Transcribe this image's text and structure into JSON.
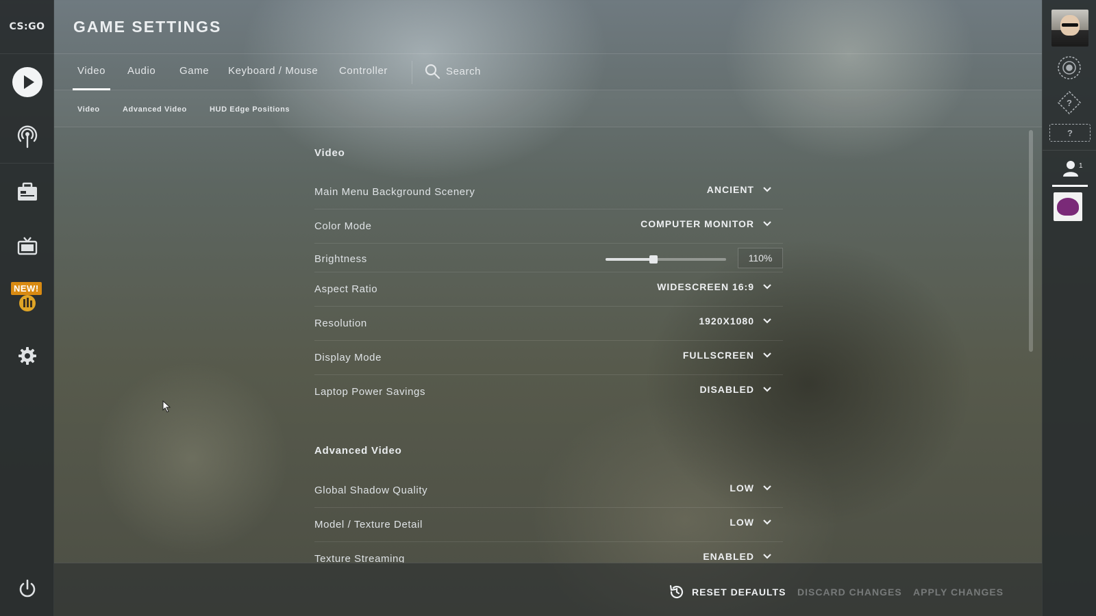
{
  "app": {
    "logo_text": "CS:GO",
    "page_title": "GAME SETTINGS",
    "new_badge": "NEW!"
  },
  "tabs": [
    {
      "label": "Video",
      "active": true
    },
    {
      "label": "Audio",
      "active": false
    },
    {
      "label": "Game",
      "active": false
    },
    {
      "label": "Keyboard / Mouse",
      "active": false
    },
    {
      "label": "Controller",
      "active": false
    }
  ],
  "search": {
    "label": "Search"
  },
  "subtabs": [
    {
      "label": "Video"
    },
    {
      "label": "Advanced Video"
    },
    {
      "label": "HUD Edge Positions"
    }
  ],
  "video_section": {
    "title": "Video",
    "rows": [
      {
        "label": "Main Menu Background Scenery",
        "value": "ANCIENT"
      },
      {
        "label": "Color Mode",
        "value": "COMPUTER MONITOR"
      },
      {
        "label": "Brightness",
        "value": "110%",
        "slider_fraction": 0.4
      },
      {
        "label": "Aspect Ratio",
        "value": "WIDESCREEN 16:9"
      },
      {
        "label": "Resolution",
        "value": "1920X1080"
      },
      {
        "label": "Display Mode",
        "value": "FULLSCREEN"
      },
      {
        "label": "Laptop Power Savings",
        "value": "DISABLED"
      }
    ]
  },
  "advanced_section": {
    "title": "Advanced Video",
    "rows": [
      {
        "label": "Global Shadow Quality",
        "value": "LOW"
      },
      {
        "label": "Model / Texture Detail",
        "value": "LOW"
      },
      {
        "label": "Texture Streaming",
        "value": "ENABLED"
      }
    ]
  },
  "right_rail": {
    "rank_unknown_1": "?",
    "rank_unknown_2": "?",
    "friends_count": "1"
  },
  "footer": {
    "reset_defaults": "RESET DEFAULTS",
    "discard_changes": "DISCARD CHANGES",
    "apply_changes": "APPLY CHANGES"
  },
  "colors": {
    "accent": "#ffffff",
    "new_badge": "#d98a12",
    "panel": "#282c2e"
  }
}
